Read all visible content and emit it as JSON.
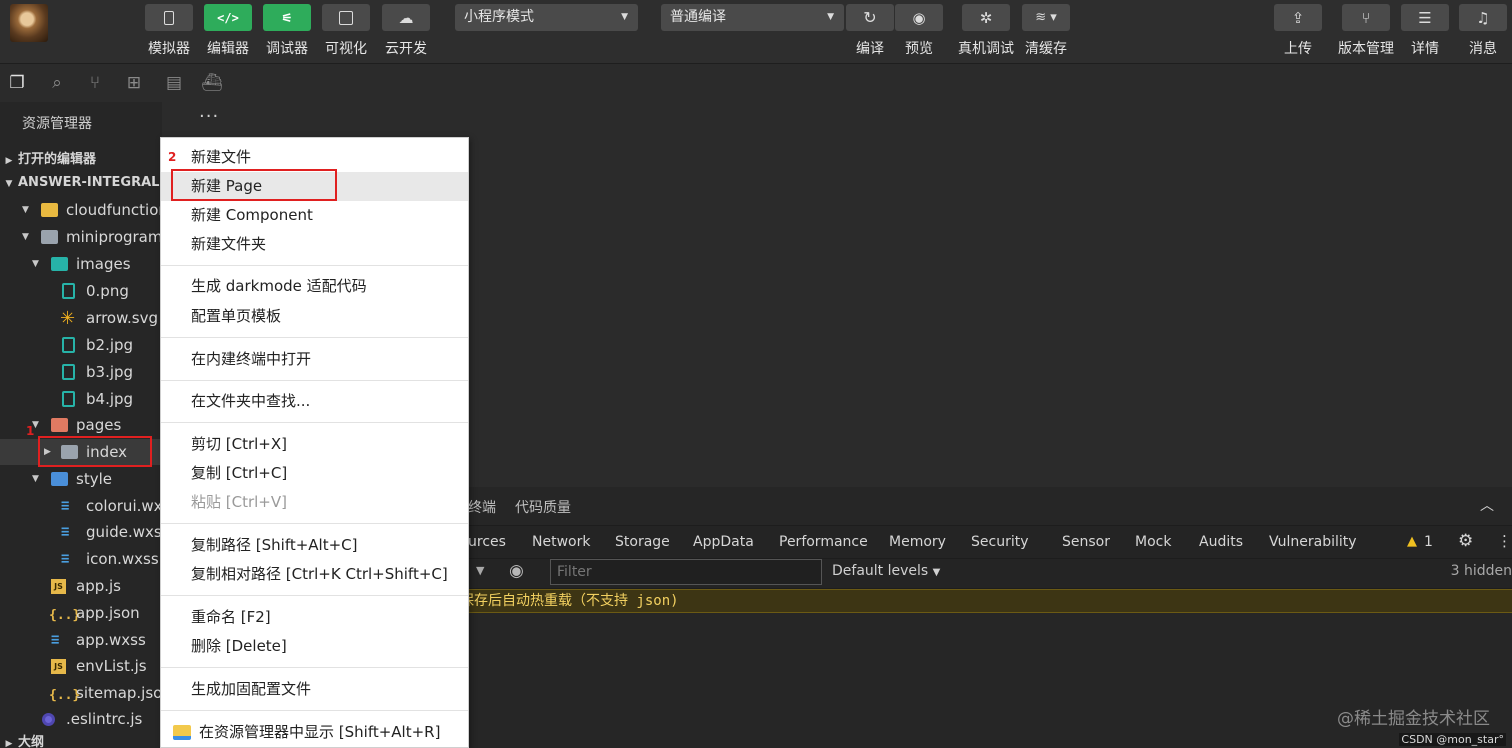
{
  "toolbar": {
    "left_buttons": [
      "模拟器",
      "编辑器",
      "调试器",
      "可视化",
      "云开发"
    ],
    "mode_select": "小程序模式",
    "compile_select": "普通编译",
    "mid_buttons": [
      "编译",
      "预览",
      "真机调试",
      "清缓存"
    ],
    "right_buttons": [
      "上传",
      "版本管理",
      "详情",
      "消息"
    ],
    "icons": {
      "simulator": "phone-icon",
      "editor": "code-icon",
      "debugger": "sliders-icon",
      "visual": "layout-icon",
      "cloud": "cloud-icon",
      "compile": "refresh-icon",
      "preview": "eye-icon",
      "remote_debug": "bug-icon",
      "clear_cache": "layers-icon",
      "upload": "upload-icon",
      "version": "branch-icon",
      "details": "menu-icon",
      "messages": "bell-icon"
    },
    "accent_color": "#2eac5b"
  },
  "sidebar": {
    "explorer_title": "资源管理器",
    "more": "···",
    "open_editors": "打开的编辑器",
    "project": "ANSWER-INTEGRAL-C",
    "outline": "大纲",
    "tree": [
      {
        "name": "cloudfunction",
        "type": "folder-yellow"
      },
      {
        "name": "miniprogram",
        "type": "folder-grey"
      },
      {
        "name": "images",
        "type": "folder-teal"
      },
      {
        "name": "0.png",
        "type": "image"
      },
      {
        "name": "arrow.svg",
        "type": "svg"
      },
      {
        "name": "b2.jpg",
        "type": "image"
      },
      {
        "name": "b3.jpg",
        "type": "image"
      },
      {
        "name": "b4.jpg",
        "type": "image"
      },
      {
        "name": "pages",
        "type": "folder-red"
      },
      {
        "name": "index",
        "type": "folder-grey"
      },
      {
        "name": "style",
        "type": "folder-blue"
      },
      {
        "name": "colorui.wxs",
        "type": "css"
      },
      {
        "name": "guide.wxss",
        "type": "css"
      },
      {
        "name": "icon.wxss",
        "type": "css"
      },
      {
        "name": "app.js",
        "type": "js"
      },
      {
        "name": "app.json",
        "type": "json"
      },
      {
        "name": "app.wxss",
        "type": "css"
      },
      {
        "name": "envList.js",
        "type": "js"
      },
      {
        "name": "sitemap.json",
        "type": "json"
      },
      {
        "name": ".eslintrc.js",
        "type": "eslint"
      }
    ],
    "annotation_1": "1"
  },
  "context_menu": {
    "annotation_2": "2",
    "items": [
      "新建文件",
      "新建 Page",
      "新建 Component",
      "新建文件夹",
      "生成 darkmode 适配代码",
      "配置单页模板",
      "在内建终端中打开",
      "在文件夹中查找...",
      "剪切  [Ctrl+X]",
      "复制  [Ctrl+C]",
      "粘贴  [Ctrl+V]",
      "复制路径  [Shift+Alt+C]",
      "复制相对路径  [Ctrl+K Ctrl+Shift+C]",
      "重命名  [F2]",
      "删除  [Delete]",
      "生成加固配置文件",
      "在资源管理器中显示  [Shift+Alt+R]"
    ]
  },
  "panel": {
    "tabs": [
      "终端",
      "代码质量"
    ],
    "devtools_tabs": [
      "urces",
      "Network",
      "Storage",
      "AppData",
      "Performance",
      "Memory",
      "Security",
      "Sensor",
      "Mock",
      "Audits",
      "Vulnerability"
    ],
    "warning_count": "1",
    "filter_placeholder": "Filter",
    "levels": "Default levels",
    "hidden": "3 hidden",
    "console_message": "保存后自动热重载（不支持 json)"
  },
  "watermark": "@稀土掘金技术社区",
  "credit": "CSDN @mon_star°"
}
